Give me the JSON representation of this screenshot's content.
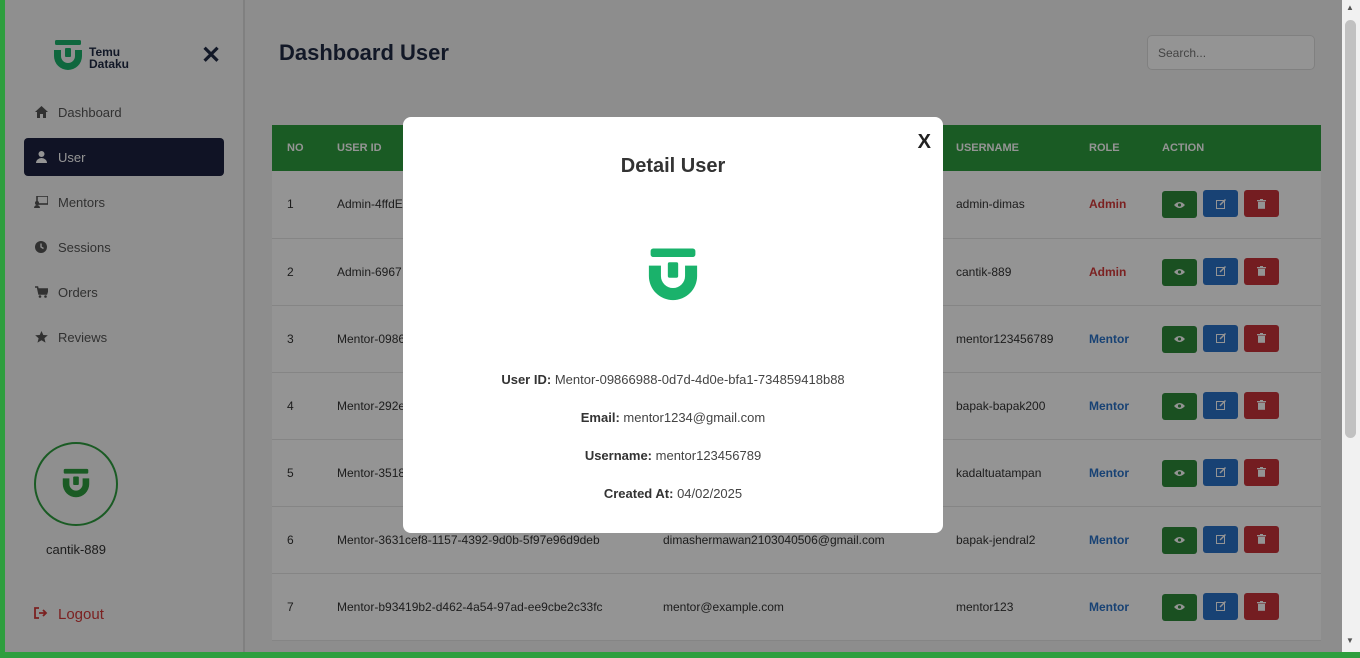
{
  "app": {
    "logo_line1": "Temu",
    "logo_line2": "Dataku"
  },
  "sidebar": {
    "close_glyph": "✕",
    "items": [
      {
        "label": "Dashboard",
        "icon": "home-icon"
      },
      {
        "label": "User",
        "icon": "user-icon",
        "active": true
      },
      {
        "label": "Mentors",
        "icon": "chalkboard-icon"
      },
      {
        "label": "Sessions",
        "icon": "clock-icon"
      },
      {
        "label": "Orders",
        "icon": "cart-icon"
      },
      {
        "label": "Reviews",
        "icon": "star-icon"
      }
    ],
    "username": "cantik-889",
    "logout_label": "Logout"
  },
  "header": {
    "title": "Dashboard User",
    "search_placeholder": "Search..."
  },
  "table": {
    "columns": [
      "NO",
      "USER ID",
      "",
      "USERNAME",
      "ROLE",
      "ACTION"
    ],
    "rows": [
      {
        "no": "1",
        "user_id": "Admin-4ffdE",
        "email": "",
        "username": "admin-dimas",
        "role": "Admin"
      },
      {
        "no": "2",
        "user_id": "Admin-6967",
        "email": "",
        "username": "cantik-889",
        "role": "Admin"
      },
      {
        "no": "3",
        "user_id": "Mentor-0986",
        "email": "",
        "username": "mentor123456789",
        "role": "Mentor"
      },
      {
        "no": "4",
        "user_id": "Mentor-292e",
        "email": "",
        "username": "bapak-bapak200",
        "role": "Mentor"
      },
      {
        "no": "5",
        "user_id": "Mentor-3518",
        "email": "",
        "username": "kadaltuatampan",
        "role": "Mentor"
      },
      {
        "no": "6",
        "user_id": "Mentor-3631cef8-1157-4392-9d0b-5f97e96d9deb",
        "email": "dimashermawan2103040506@gmail.com",
        "username": "bapak-jendral2",
        "role": "Mentor"
      },
      {
        "no": "7",
        "user_id": "Mentor-b93419b2-d462-4a54-97ad-ee9cbe2c33fc",
        "email": "mentor@example.com",
        "username": "mentor123",
        "role": "Mentor"
      }
    ]
  },
  "modal": {
    "close_label": "X",
    "title": "Detail User",
    "user_id_label": "User ID:",
    "user_id": "Mentor-09866988-0d7d-4d0e-bfa1-734859418b88",
    "email_label": "Email:",
    "email": "mentor1234@gmail.com",
    "username_label": "Username:",
    "username": "mentor123456789",
    "created_label": "Created At:",
    "created_at": "04/02/2025"
  },
  "colors": {
    "brand_green": "#2e9e3e",
    "logo_green": "#1ab26b",
    "navy": "#1c2240",
    "admin_red": "#d43a3a",
    "mentor_blue": "#2a73c8"
  }
}
